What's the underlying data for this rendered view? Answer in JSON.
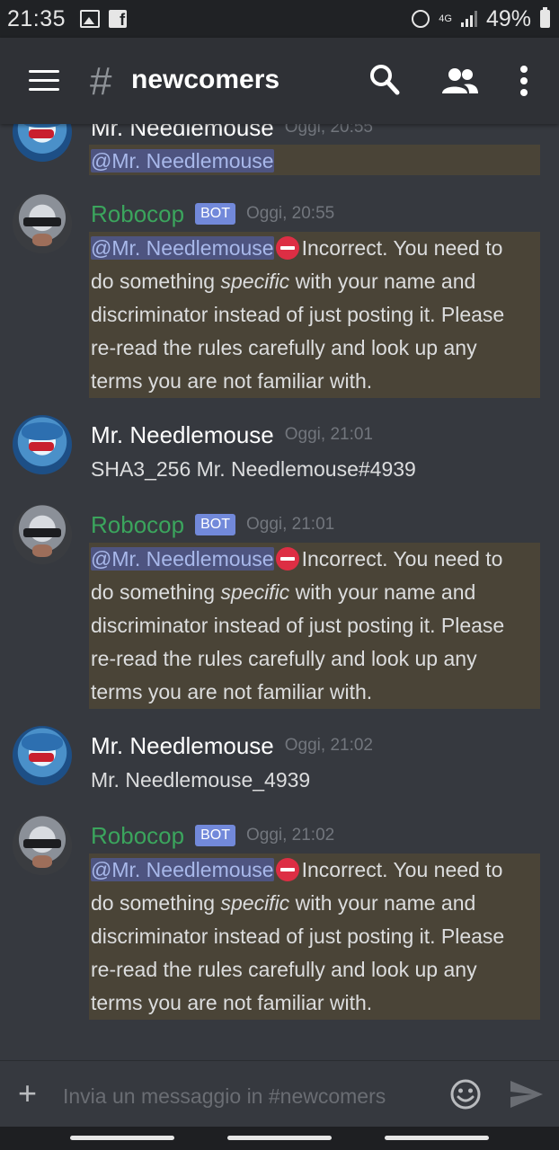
{
  "status_bar": {
    "time": "21:35",
    "network": "4G",
    "battery": "49%"
  },
  "app_bar": {
    "channel_prefix": "#",
    "channel_name": "newcomers",
    "icons": [
      "menu-icon",
      "search-icon",
      "members-icon",
      "more-icon"
    ]
  },
  "messages": [
    {
      "author": "Mr. Needlemouse",
      "timestamp": "Oggi, 20:55",
      "mention": "@Mr. Needlemouse"
    },
    {
      "author": "Robocop",
      "bot_badge": "BOT",
      "timestamp": "Oggi, 20:55",
      "mention": "@Mr. Needlemouse",
      "lines": [
        "Incorrect. You need to",
        "do something",
        "specific",
        "with your name and",
        "discriminator instead of just posting it. Please",
        "re-read the rules carefully and look up any",
        "terms you are not familiar with."
      ]
    },
    {
      "author": "Mr. Needlemouse",
      "timestamp": "Oggi, 21:01",
      "text": "SHA3_256 Mr. Needlemouse#4939"
    },
    {
      "author": "Robocop",
      "bot_badge": "BOT",
      "timestamp": "Oggi, 21:01",
      "mention": "@Mr. Needlemouse",
      "lines": [
        "Incorrect. You need to",
        "do something",
        "specific",
        "with your name and",
        "discriminator instead of just posting it. Please",
        "re-read the rules carefully and look up any",
        "terms you are not familiar with."
      ]
    },
    {
      "author": "Mr. Needlemouse",
      "timestamp": "Oggi, 21:02",
      "text": "Mr. Needlemouse_4939"
    },
    {
      "author": "Robocop",
      "bot_badge": "BOT",
      "timestamp": "Oggi, 21:02",
      "mention": "@Mr. Needlemouse",
      "lines": [
        "Incorrect. You need to",
        "do something",
        "specific",
        "with your name and",
        "discriminator instead of just posting it. Please",
        "re-read the rules carefully and look up any",
        "terms you are not familiar with."
      ]
    }
  ],
  "composer": {
    "placeholder": "Invia un messaggio in #newcomers"
  },
  "colors": {
    "background": "#36393f",
    "app_bar": "#2f3136",
    "bot_name": "#3ba55d",
    "bot_badge": "#7289da",
    "mention_highlight": "#4a4437",
    "mention_text": "#a8b8ea"
  }
}
